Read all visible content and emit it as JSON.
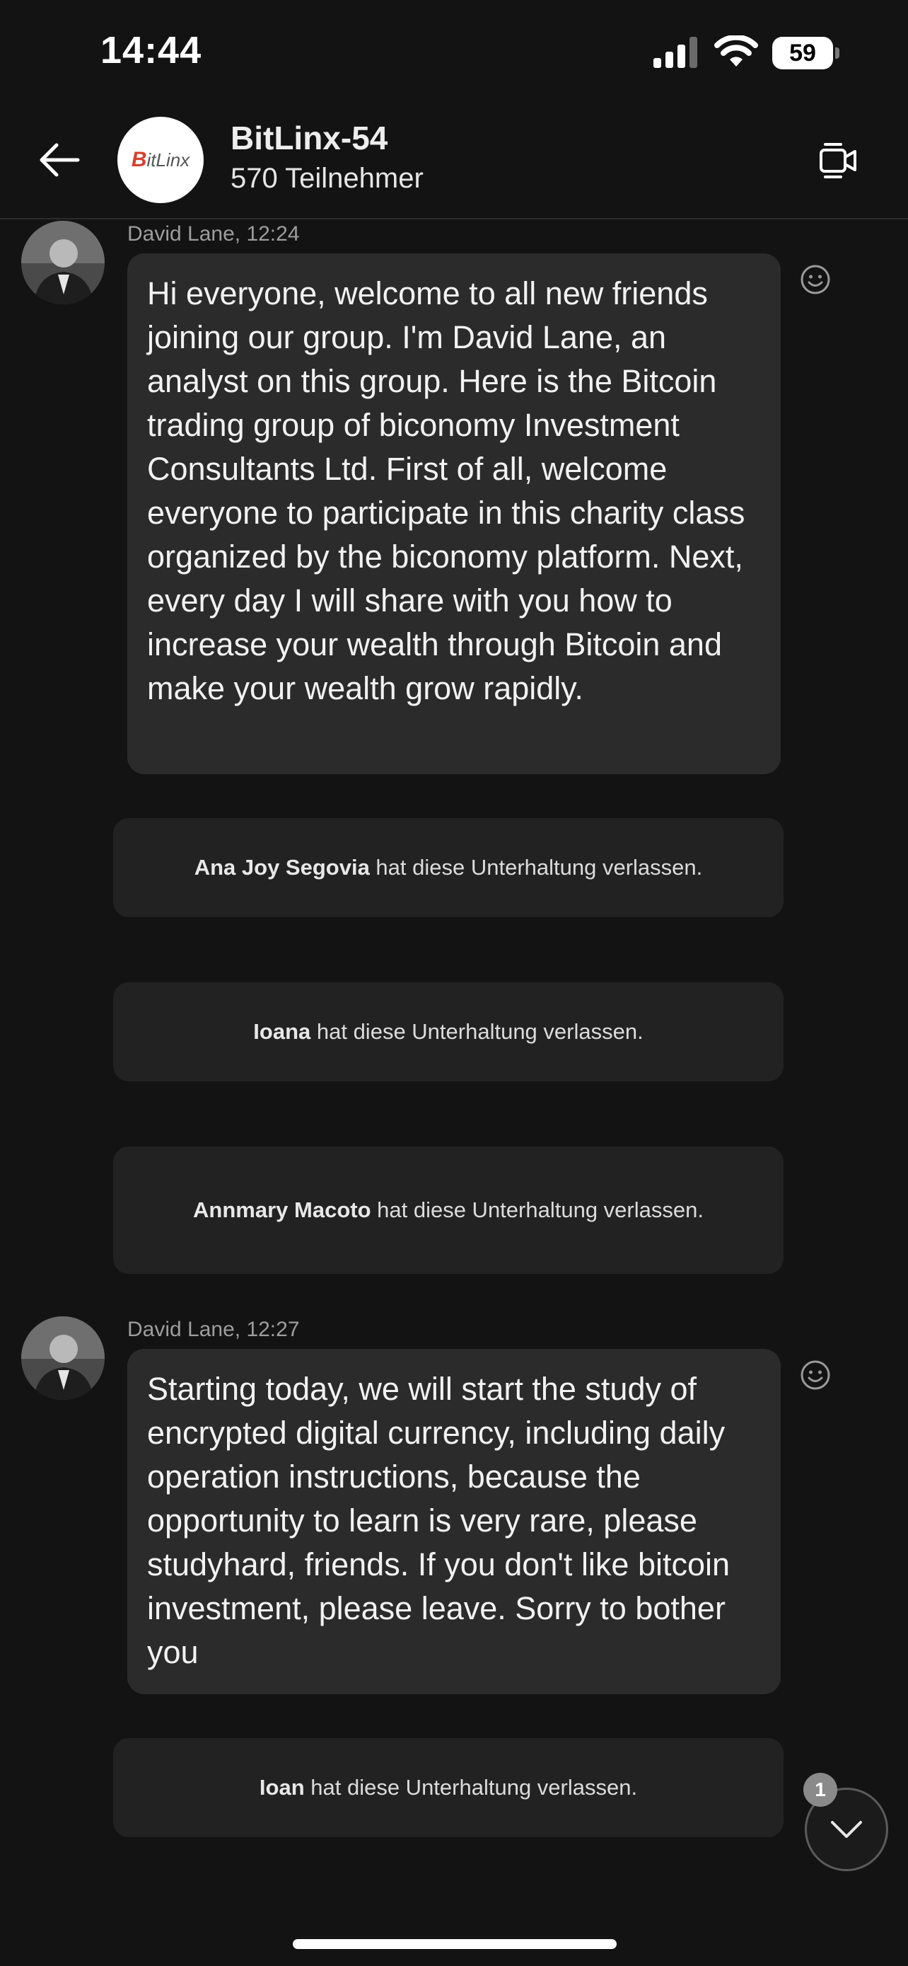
{
  "status_bar": {
    "time": "14:44",
    "battery": "59"
  },
  "header": {
    "title": "BitLinx-54",
    "subtitle": "570 Teilnehmer",
    "logo_text": {
      "b": "B",
      "rest": "itLinx"
    }
  },
  "messages": [
    {
      "sender": "David Lane, 12:24",
      "text": "Hi everyone, welcome to all new friends joining our group. I'm David Lane, an analyst on this group. Here is the Bitcoin trading group of biconomy Investment Consultants Ltd. First of all, welcome everyone to participate in this charity class organized by the biconomy platform. Next, every day I will share with you how to increase your wealth through Bitcoin and make your wealth grow rapidly."
    },
    {
      "sender": "David Lane, 12:27",
      "text": "Starting today, we will start the study of encrypted digital currency, including daily operation instructions, because the opportunity to learn is very rare, please studyhard, friends. If you don't like bitcoin investment, please leave. Sorry to bother you"
    }
  ],
  "system_notices": [
    {
      "name": "Ana Joy Segovia",
      "text": " hat diese Unterhaltung verlassen."
    },
    {
      "name": "Ioana",
      "text": " hat diese Unterhaltung verlassen."
    },
    {
      "name": "Annmary Macoto",
      "text": " hat diese Unterhaltung verlassen."
    },
    {
      "name": "Ioan",
      "text": " hat diese Unterhaltung verlassen."
    }
  ],
  "scroll_badge": "1",
  "colors": {
    "background": "#131313",
    "bubble": "#2b2b2b",
    "notice": "#222222",
    "logo_accent": "#d6402d"
  }
}
